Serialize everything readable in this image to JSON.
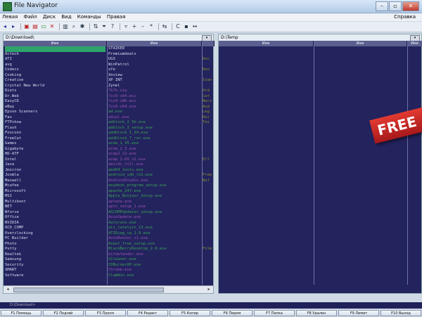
{
  "window": {
    "title": "File Navigator"
  },
  "menu": {
    "items": [
      "Левая",
      "Файл",
      "Диск",
      "Вид",
      "Команды",
      "Правая"
    ],
    "right": "Справка"
  },
  "toolbar": {
    "icons": [
      "back-icon",
      "forward-icon",
      "copy-icon",
      "move-icon",
      "delete-icon",
      "close-icon",
      "folder-icon",
      "view-icon",
      "find-icon",
      "settings-icon",
      "sort-icon",
      "filter-icon",
      "plus-icon",
      "minus-icon",
      "star-icon",
      "network-icon",
      "compare-icon",
      "drive-icon",
      "swap-icon"
    ]
  },
  "left_panel": {
    "path": "D:\\Download\\",
    "col1_header": "Имя",
    "col2_header": "Имя",
    "col1": [
      "",
      "Actech",
      "ATI",
      "avg",
      "Codecs",
      "Cooking",
      "Creative",
      "Crystal New World",
      "Diets",
      "Dr.Web",
      "EasyCD",
      "eBay",
      "Epson Scanners",
      "Fax",
      "FTPshow",
      "Flash",
      "Foxconn",
      "FreeCat",
      "Games",
      "Gigabyte",
      "HD-ATF",
      "Intel",
      "Java",
      "Jmicron",
      "Joomla",
      "Maxwell",
      "Mcafee",
      "Microsoft",
      "MSI",
      "Multiboot",
      "NET",
      "Nforce",
      "Office",
      "NVIDIA",
      "OCD_COMP",
      "Overclocking",
      "PC Builder",
      "Photo",
      "Putty",
      "Realtek",
      "Samsung",
      "Security",
      "SMART",
      "Software"
    ],
    "col2": [
      {
        "t": "STAIKER",
        "k": "dir"
      },
      {
        "t": "Premiumdeals",
        "k": "dir"
      },
      {
        "t": "UGS",
        "k": "dir"
      },
      {
        "t": "WinPatrol",
        "k": "dir"
      },
      {
        "t": "xfe",
        "k": "dir"
      },
      {
        "t": "Xnview",
        "k": "dir"
      },
      {
        "t": "XP INT",
        "k": "dir"
      },
      {
        "t": "Zynel",
        "k": "dir"
      },
      {
        "t": "7k7k.zip",
        "k": "file"
      },
      {
        "t": "7zz9-x64.msi",
        "k": "file"
      },
      {
        "t": "7zz9-x86.msi",
        "k": "file"
      },
      {
        "t": "7zz9-x64.exe",
        "k": "file"
      },
      {
        "t": "ad.exe",
        "k": "exe"
      },
      {
        "t": "adcpl.exe",
        "k": "file"
      },
      {
        "t": "adblock_2_5b.exe",
        "k": "exe"
      },
      {
        "t": "adblock_3_setup.exe",
        "k": "exe"
      },
      {
        "t": "addblock_1_34.exe",
        "k": "exe"
      },
      {
        "t": "addblock_7_rar.exe",
        "k": "exe"
      },
      {
        "t": "aida_1_35.exe",
        "k": "exe"
      },
      {
        "t": "aida_2_3.exe",
        "k": "file"
      },
      {
        "t": "aimp2_x2.exe",
        "k": "file"
      },
      {
        "t": "aimp_3.60_x2.exe",
        "k": "file"
      },
      {
        "t": "amirdc_full.exe",
        "k": "file"
      },
      {
        "t": "amd64_tools.exe",
        "k": "exe"
      },
      {
        "t": "android_sdk_r22.exe",
        "k": "exe"
      },
      {
        "t": "AndroidStudio.exe",
        "k": "file"
      },
      {
        "t": "anydesk_program_setup.exe",
        "k": "exe"
      },
      {
        "t": "apache_247.exe",
        "k": "exe"
      },
      {
        "t": "Apple_Bonjour_Setup.exe",
        "k": "exe"
      },
      {
        "t": "aptana.exe",
        "k": "file"
      },
      {
        "t": "apts_setup_1.exe",
        "k": "file"
      },
      {
        "t": "ASCOMPUpdater_setup.exe",
        "k": "exe"
      },
      {
        "t": "AsusUpdate.exe",
        "k": "file"
      },
      {
        "t": "Autoruns.exe",
        "k": "exe"
      },
      {
        "t": "ati_catalyst_13.exe",
        "k": "exe"
      },
      {
        "t": "ATIDiag_cp.1.0.exe",
        "k": "exe"
      },
      {
        "t": "AutoRunner_v1.exe",
        "k": "file"
      },
      {
        "t": "Avast_free_setup.exe",
        "k": "exe"
      },
      {
        "t": "BlackBerryDesktop_2.0.exe",
        "k": "exe"
      },
      {
        "t": "bitdefender.exe",
        "k": "file"
      },
      {
        "t": "CCleaner.exe",
        "k": "exe"
      },
      {
        "t": "CDBurnerXP.exe",
        "k": "exe"
      },
      {
        "t": "Chrome.exe",
        "k": "file"
      },
      {
        "t": "ClamWin.exe",
        "k": "exe"
      }
    ],
    "col3": [
      "",
      "",
      "Doc",
      "",
      "Roo",
      "",
      "Ivan",
      "",
      "Ord",
      "Cat",
      "Nerv",
      "Aud",
      "Leg",
      "Rul",
      "Tes",
      "",
      "",
      "",
      "",
      "",
      "",
      "Erl",
      "",
      "",
      "Free",
      "Buf",
      "",
      "",
      "",
      "",
      "",
      "",
      "",
      "",
      "",
      "",
      "",
      "",
      "Film",
      "",
      "",
      "",
      "",
      ""
    ]
  },
  "right_panel": {
    "path": "D:\\Temp",
    "col1_header": "Имя",
    "col2_header": "Имя",
    "col3_header": "Имя"
  },
  "banner": {
    "text": "FREE"
  },
  "cmdline": {
    "text": "D:\\Download>"
  },
  "fkeys": [
    "F1 Помощь",
    "F2 Подсвй",
    "F3 Просм",
    "F4 Редакт",
    "F5 Копир",
    "F6 Перем",
    "F7 Папка",
    "F8 Удален",
    "F9 Лимит",
    "F10 Выход"
  ]
}
